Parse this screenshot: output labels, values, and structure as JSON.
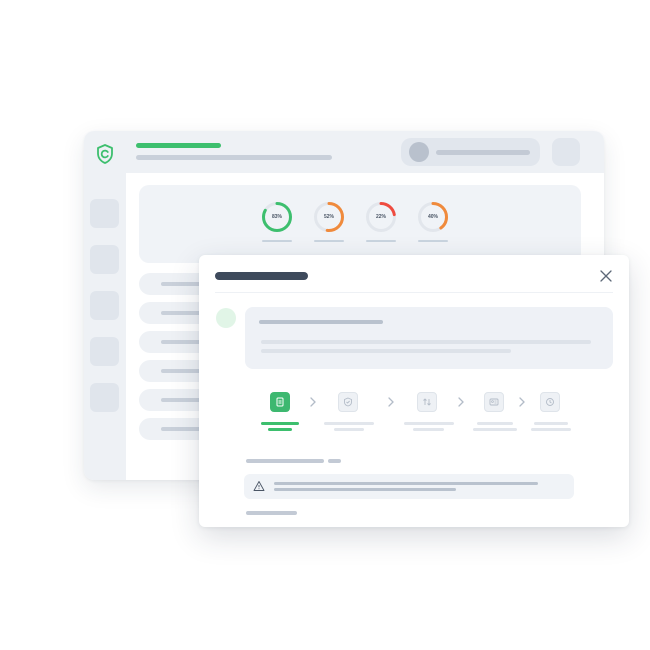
{
  "theme": {
    "accent": "#3dbf6e",
    "orange": "#f08a3c",
    "red": "#ef4b3f",
    "track": "#e2e6ec",
    "text_dark": "#3e4a5c"
  },
  "app": {
    "logo_icon": "shield-c-logo-icon",
    "sidebar_item_count": 5,
    "list_row_count": 6
  },
  "stats": [
    {
      "label": "83%",
      "value": 83,
      "color": "#3dbf6e"
    },
    {
      "label": "52%",
      "value": 52,
      "color": "#f08a3c"
    },
    {
      "label": "22%",
      "value": 22,
      "color": "#ef4b3f"
    },
    {
      "label": "40%",
      "value": 40,
      "color": "#f08a3c"
    }
  ],
  "modal": {
    "close_icon": "close-icon",
    "steps": [
      {
        "icon": "document-icon",
        "active": true
      },
      {
        "icon": "shield-check-icon",
        "active": false
      },
      {
        "icon": "swap-arrows-icon",
        "active": false
      },
      {
        "icon": "id-card-icon",
        "active": false
      },
      {
        "icon": "clock-icon",
        "active": false
      }
    ],
    "warning_icon": "warning-icon"
  }
}
